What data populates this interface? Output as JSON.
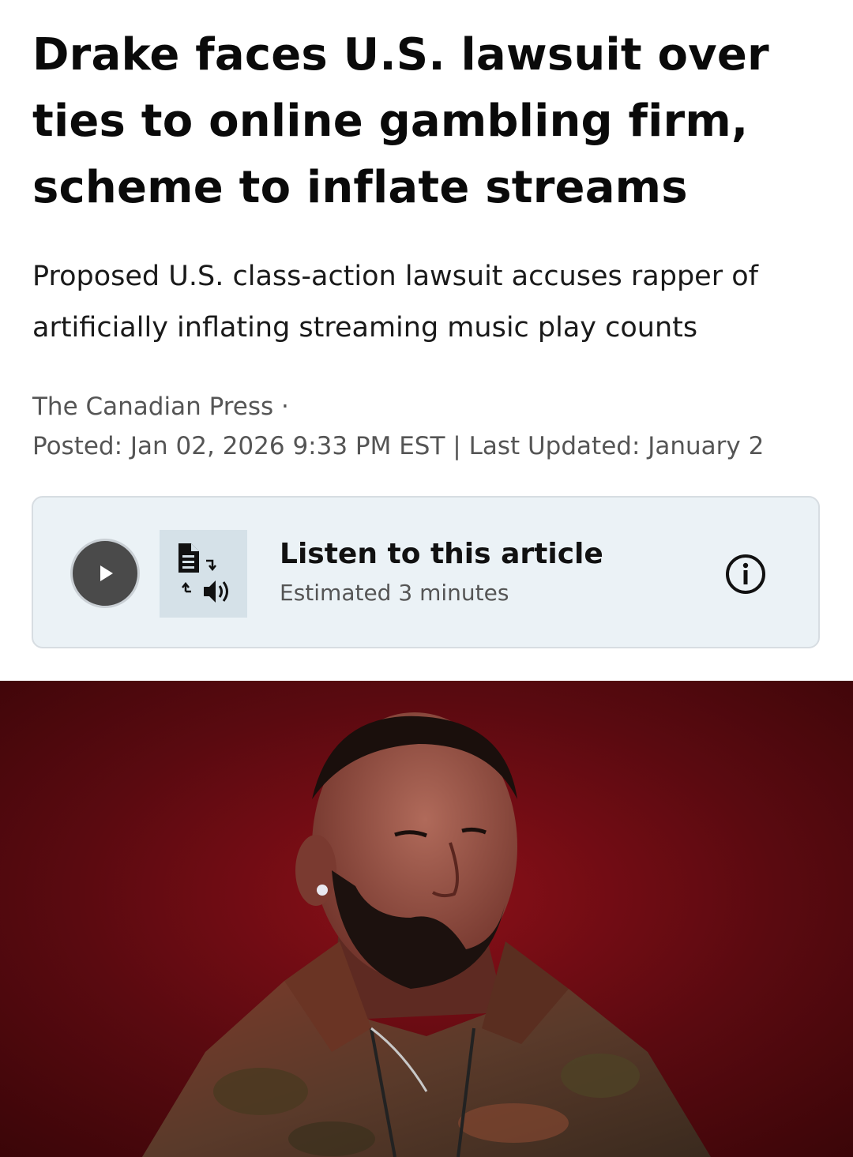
{
  "article": {
    "headline": "Drake faces U.S. lawsuit over ties to online gambling firm, scheme to inflate streams",
    "dek": "Proposed U.S. class-action lawsuit accuses rapper of artificially inflating streaming music play counts",
    "source": "The Canadian Press ·",
    "timestamp": "Posted: Jan 02, 2026 9:33 PM EST | Last Updated: January 2"
  },
  "listen": {
    "title": "Listen to this article",
    "estimate": "Estimated 3 minutes",
    "play_icon": "play-icon",
    "tts_icon": "text-to-speech-icon",
    "info_icon": "info-icon"
  },
  "colors": {
    "card_background": "#ebf2f6",
    "card_border": "#d7dde2",
    "play_button": "#4a4a4a",
    "photo_background": "#6b0a12"
  }
}
